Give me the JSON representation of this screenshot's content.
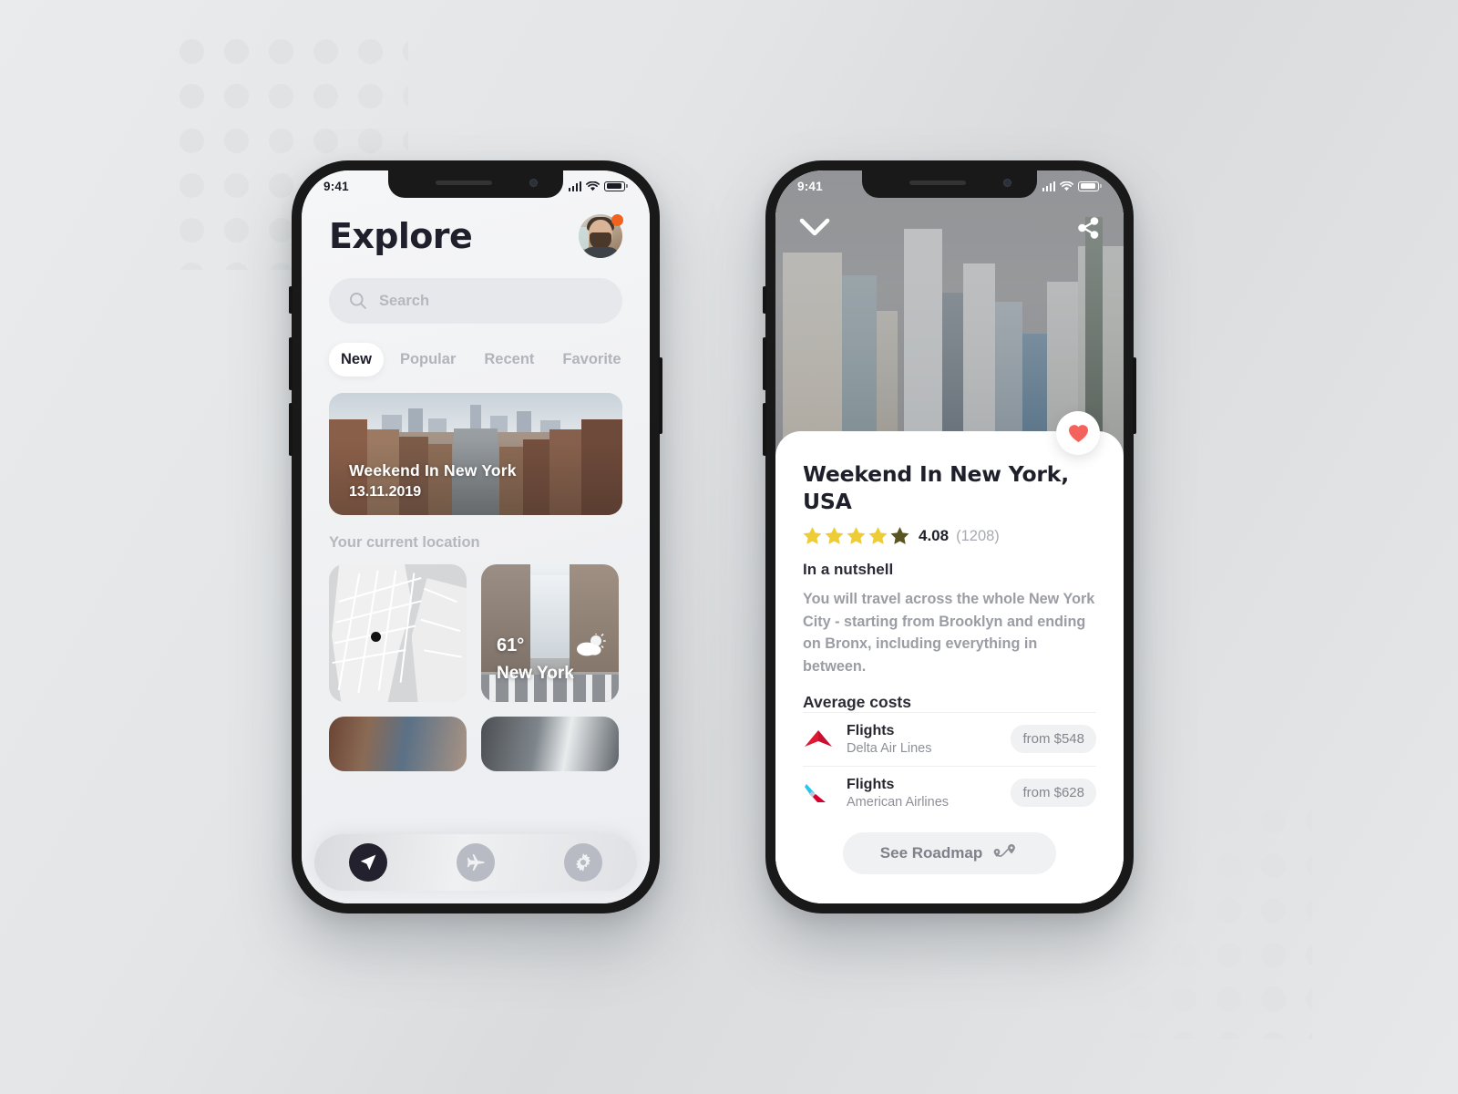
{
  "background": {
    "base_color": "#e4e6e8",
    "dot_color": "#e0e2e3"
  },
  "phone_explore": {
    "status_bar": {
      "time": "9:41",
      "signal_icon": "signal-bars-icon",
      "wifi_icon": "wifi-icon",
      "battery_icon": "battery-icon"
    },
    "header": {
      "title": "Explore",
      "avatar_icon": "avatar",
      "notification_badge_color": "#f1621f"
    },
    "search": {
      "placeholder": "Search",
      "icon": "search-icon"
    },
    "tabs": [
      {
        "label": "New",
        "active": true
      },
      {
        "label": "Popular",
        "active": false
      },
      {
        "label": "Recent",
        "active": false
      },
      {
        "label": "Favorite",
        "active": false
      }
    ],
    "hero_card": {
      "title": "Weekend In New York",
      "date": "13.11.2019"
    },
    "section_label": "Your current location",
    "location_cards": [
      {
        "type": "map",
        "name": "map-tile"
      },
      {
        "type": "weather",
        "temperature": "61°",
        "city": "New York",
        "weather_icon": "partly-cloudy-icon"
      }
    ],
    "tab_bar": [
      {
        "icon": "navigation-arrow-icon",
        "active": true
      },
      {
        "icon": "airplane-icon",
        "active": false
      },
      {
        "icon": "gear-icon",
        "active": false
      }
    ]
  },
  "phone_detail": {
    "status_bar": {
      "time": "9:41",
      "signal_icon": "signal-bars-icon",
      "wifi_icon": "wifi-icon",
      "battery_icon": "battery-icon"
    },
    "nav": {
      "back_icon": "chevron-down-icon",
      "share_icon": "share-icon"
    },
    "favorite": {
      "icon": "heart-icon",
      "color": "#f4625c",
      "active": true
    },
    "title": "Weekend In New York, USA",
    "rating": {
      "stars_filled": 4,
      "stars_total": 5,
      "score": "4.08",
      "count": "(1208)",
      "star_color": "#eecc33",
      "partial_star_color": "#5a5520"
    },
    "nutshell_heading": "In a nutshell",
    "nutshell_text": "You will travel across the whole New York City - starting from Brooklyn and ending on Bronx, including everything in between.",
    "average_costs_heading": "Average costs",
    "costs": [
      {
        "logo": "delta-air-lines-logo",
        "name": "Flights",
        "provider": "Delta Air Lines",
        "price": "from $548"
      },
      {
        "logo": "american-airlines-logo",
        "name": "Flights",
        "provider": "American Airlines",
        "price": "from $628"
      }
    ],
    "roadmap_button": {
      "label": "See Roadmap",
      "icon": "route-pins-icon"
    }
  }
}
